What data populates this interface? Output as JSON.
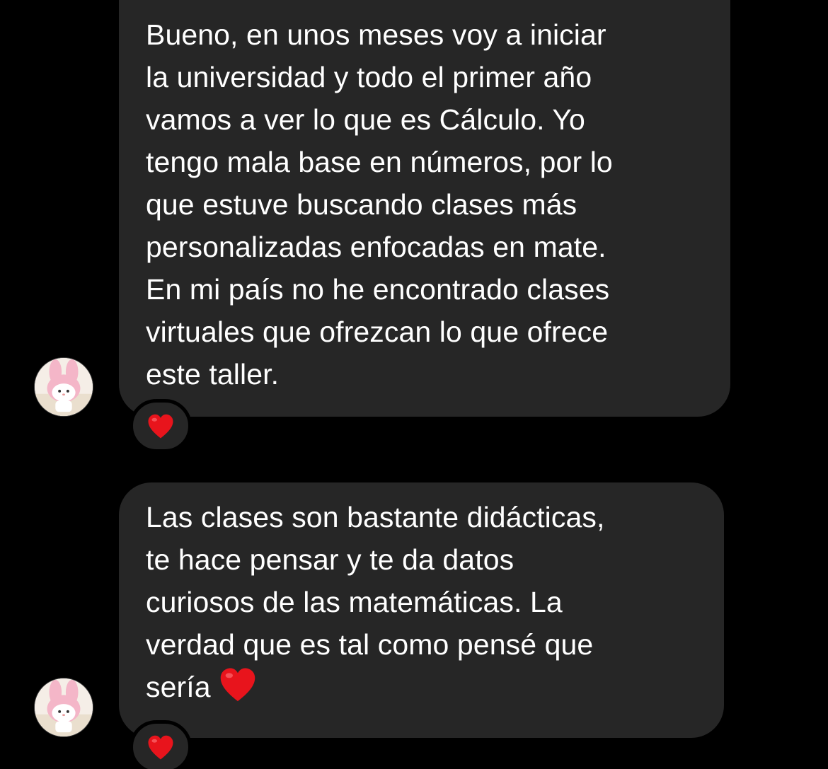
{
  "colors": {
    "background": "#000000",
    "bubble": "#262626",
    "text": "#ffffff",
    "heart": "#e8141c"
  },
  "messages": [
    {
      "lines": [
        "Bueno, en unos meses voy a iniciar",
        "la universidad y todo el primer año",
        "vamos a ver lo que es Cálculo. Yo",
        "tengo mala base en números, por lo",
        "que estuve buscando clases más",
        "personalizadas enfocadas en mate.",
        "En mi país no he encontrado clases",
        "virtuales que ofrezcan lo que ofrece",
        "este taller."
      ],
      "reaction": "❤️",
      "avatar_icon": "my-melody-avatar"
    },
    {
      "lines": [
        "Las clases son bastante didácticas,",
        "te hace pensar y te da datos",
        "curiosos de las matemáticas. La",
        "verdad que es tal como pensé que",
        "sería"
      ],
      "trailing_emoji": "❤️",
      "reaction": "❤️",
      "avatar_icon": "my-melody-avatar"
    }
  ]
}
